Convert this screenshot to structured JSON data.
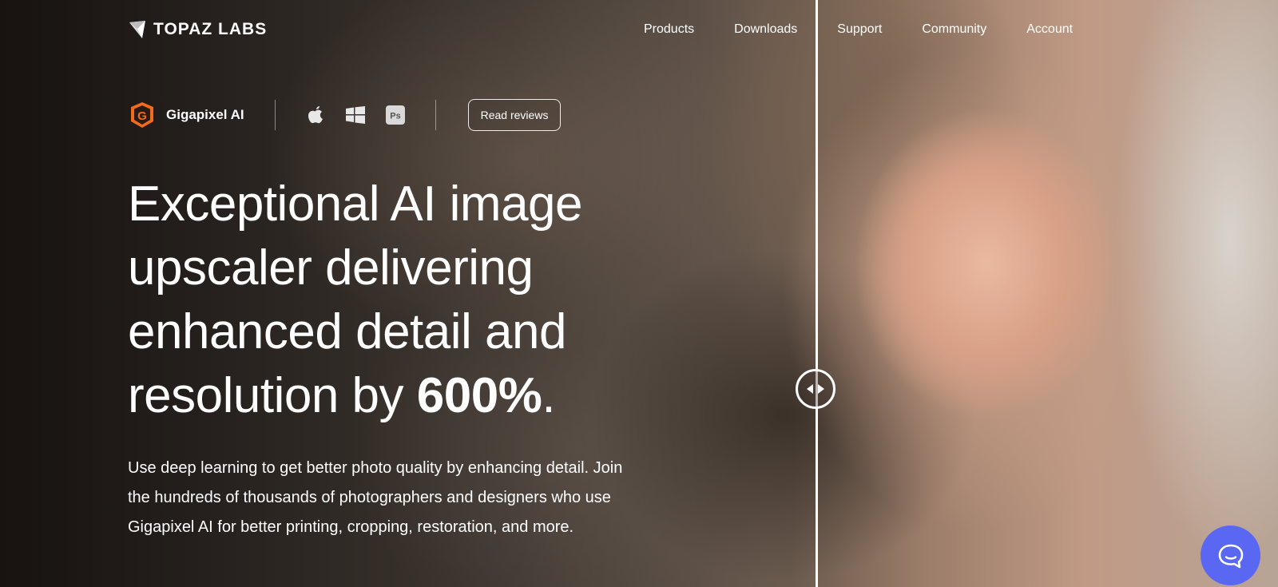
{
  "brand": {
    "name": "TOPAZ LABS"
  },
  "nav": {
    "items": [
      {
        "label": "Products"
      },
      {
        "label": "Downloads"
      },
      {
        "label": "Support"
      },
      {
        "label": "Community"
      },
      {
        "label": "Account"
      }
    ]
  },
  "product": {
    "name": "Gigapixel AI",
    "icon": "gigapixel-g-icon",
    "accent_color": "#f26a1b",
    "platforms": [
      "apple-icon",
      "windows-icon",
      "photoshop-icon"
    ],
    "photoshop_label": "Ps",
    "reviews_label": "Read reviews"
  },
  "hero": {
    "headline_main": "Exceptional AI image upscaler delivering enhanced detail and resolution by ",
    "headline_emphasis": "600%",
    "headline_end": ".",
    "description": "Use deep learning to get better photo quality by enhancing detail. Join the hundreds of thousands of photographers and designers who use Gigapixel AI for better printing, cropping, restoration, and more."
  },
  "comparison": {
    "handle_icon": "left-right-arrows-icon"
  },
  "chat": {
    "icon": "chat-bubble-icon",
    "color": "#5a67f2"
  }
}
